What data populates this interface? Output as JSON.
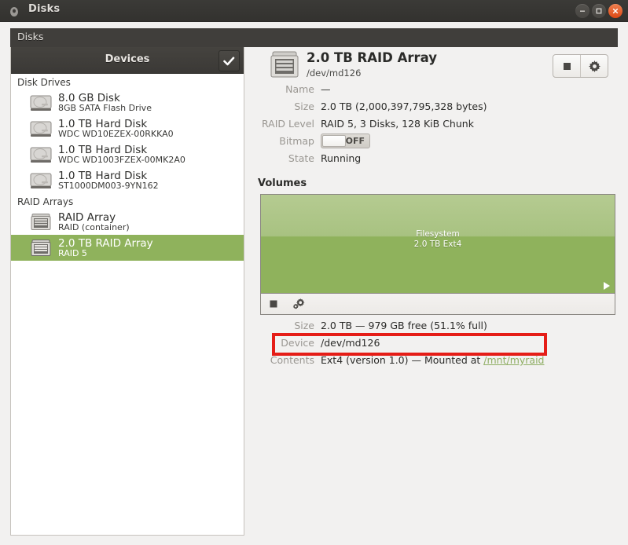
{
  "window": {
    "title": "Disks",
    "app_icon": "disk-app-icon",
    "controls": [
      {
        "name": "minimize",
        "glyph": "minus"
      },
      {
        "name": "maximize",
        "glyph": "square"
      },
      {
        "name": "close",
        "glyph": "cross"
      }
    ]
  },
  "menubar": {
    "items": [
      "Disks"
    ]
  },
  "sidebar": {
    "header_title": "Devices",
    "header_button": "check-button",
    "groups": [
      {
        "label": "Disk Drives",
        "items": [
          {
            "title": "8.0 GB Disk",
            "subtitle": "8GB SATA Flash Drive",
            "icon": "hard-disk-icon",
            "selected": false
          },
          {
            "title": "1.0 TB Hard Disk",
            "subtitle": "WDC WD10EZEX-00RKKA0",
            "icon": "hard-disk-icon",
            "selected": false
          },
          {
            "title": "1.0 TB Hard Disk",
            "subtitle": "WDC WD1003FZEX-00MK2A0",
            "icon": "hard-disk-icon",
            "selected": false
          },
          {
            "title": "1.0 TB Hard Disk",
            "subtitle": "ST1000DM003-9YN162",
            "icon": "hard-disk-icon",
            "selected": false
          }
        ]
      },
      {
        "label": "RAID Arrays",
        "items": [
          {
            "title": "RAID Array",
            "subtitle": "RAID (container)",
            "icon": "raid-array-icon",
            "selected": false
          },
          {
            "title": "2.0 TB RAID Array",
            "subtitle": "RAID 5",
            "icon": "raid-array-icon",
            "selected": true
          }
        ]
      }
    ]
  },
  "detail": {
    "icon": "raid-array-icon",
    "title": "2.0 TB RAID Array",
    "subtitle": "/dev/md126",
    "actions": [
      {
        "name": "stop-array-button",
        "icon": "stop-icon"
      },
      {
        "name": "array-options-button",
        "icon": "gear-icon"
      }
    ],
    "fields": [
      {
        "label": "Name",
        "value": "—"
      },
      {
        "label": "Size",
        "value": "2.0 TB (2,000,397,795,328 bytes)"
      },
      {
        "label": "RAID Level",
        "value": "RAID 5, 3 Disks, 128 KiB Chunk"
      },
      {
        "label": "Bitmap",
        "value": "OFF",
        "type": "toggle",
        "state": "off"
      },
      {
        "label": "State",
        "value": "Running"
      }
    ],
    "volumes_heading": "Volumes",
    "volume": {
      "graphic_line1": "Filesystem",
      "graphic_line2": "2.0 TB Ext4",
      "fill_color": "#8fb25c",
      "toolbar": [
        {
          "name": "unmount-volume-button",
          "icon": "stop-icon"
        },
        {
          "name": "volume-options-button",
          "icon": "gears-icon"
        }
      ],
      "fields": [
        {
          "label": "Size",
          "value": "2.0 TB — 979 GB free (51.1% full)",
          "highlighted": true
        },
        {
          "label": "Device",
          "value": "/dev/md126"
        },
        {
          "label": "Contents",
          "value": "Ext4 (version 1.0) — Mounted at ",
          "link": "/mnt/myraid"
        }
      ]
    }
  },
  "annotation": {
    "highlight_color": "#e51d17",
    "target": "volume-size-field"
  }
}
